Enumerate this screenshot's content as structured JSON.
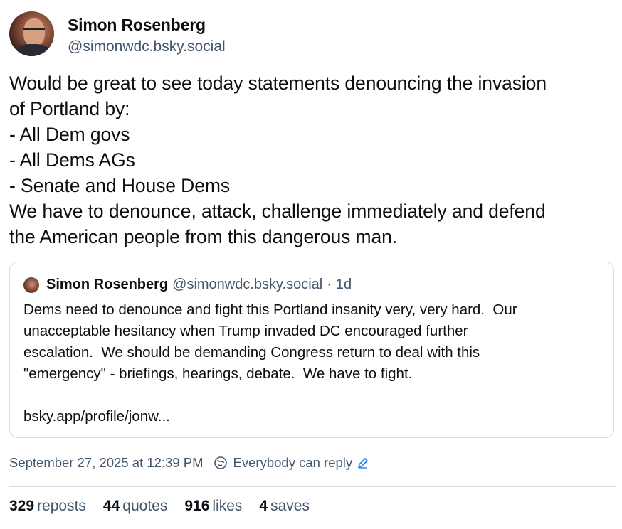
{
  "author": {
    "display_name": "Simon Rosenberg",
    "handle": "@simonwdc.bsky.social"
  },
  "post": {
    "lines": [
      "Would be great to see today statements denouncing the invasion",
      "of Portland by:",
      "- All Dem govs",
      "- All Dems AGs",
      "- Senate and House Dems",
      "We have to denounce, attack, challenge immediately and defend",
      "the American people from this dangerous man."
    ]
  },
  "quote": {
    "display_name": "Simon Rosenberg",
    "handle": "@simonwdc.bsky.social",
    "separator": "·",
    "time": "1d",
    "lines": [
      "Dems need to denounce and fight this Portland insanity very, very hard.  Our",
      "unacceptable hesitancy when Trump invaded DC encouraged further",
      "escalation.  We should be demanding Congress return to deal with this",
      "\"emergency\" - briefings, hearings, debate.  We have to fight.",
      "",
      "bsky.app/profile/jonw..."
    ]
  },
  "meta": {
    "date": "September 27, 2025 at 12:39 PM",
    "reply_setting": "Everybody can reply"
  },
  "stats": {
    "reposts_count": "329",
    "reposts_label": "reposts",
    "quotes_count": "44",
    "quotes_label": "quotes",
    "likes_count": "916",
    "likes_label": "likes",
    "saves_count": "4",
    "saves_label": "saves"
  },
  "colors": {
    "text": "#0b0f14",
    "muted": "#42576c",
    "border": "#d4dbe2",
    "accent": "#1083fe"
  },
  "icons": {
    "reply_setting": "globe-reply-icon",
    "edit": "pencil-icon"
  }
}
